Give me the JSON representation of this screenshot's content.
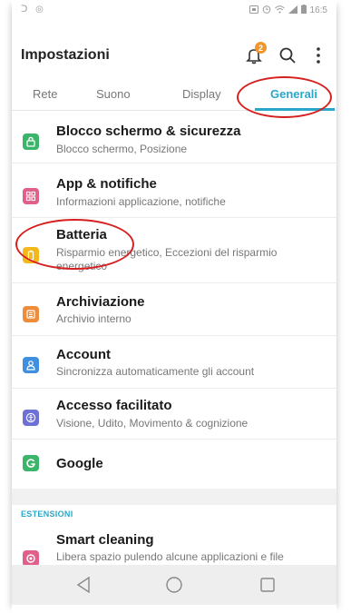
{
  "statusbar": {
    "left_icons": "ᑐ ◎",
    "time": "16:5"
  },
  "appbar": {
    "title": "Impostazioni",
    "notification_count": "2"
  },
  "tabs": [
    {
      "label": "Rete"
    },
    {
      "label": "Suono"
    },
    {
      "label": "Display"
    },
    {
      "label": "Generali"
    }
  ],
  "items": [
    {
      "title": "Blocco schermo & sicurezza",
      "subtitle": "Blocco schermo, Posizione",
      "icon": "lock-icon",
      "color": "#3bb56a"
    },
    {
      "title": "App & notifiche",
      "subtitle": "Informazioni applicazione, notifiche",
      "icon": "apps-icon",
      "color": "#e0608a"
    },
    {
      "title": "Batteria",
      "subtitle": "Risparmio energetico, Eccezioni del risparmio energetico",
      "icon": "battery-icon",
      "color": "#f2b81c"
    },
    {
      "title": "Archiviazione",
      "subtitle": "Archivio interno",
      "icon": "storage-icon",
      "color": "#ee8c39"
    },
    {
      "title": "Account",
      "subtitle": "Sincronizza automaticamente gli account",
      "icon": "account-icon",
      "color": "#3e8fe0"
    },
    {
      "title": "Accesso facilitato",
      "subtitle": "Visione, Udito, Movimento & cognizione",
      "icon": "accessibility-icon",
      "color": "#6e71d6"
    },
    {
      "title": "Google",
      "subtitle": "",
      "icon": "google-icon",
      "color": "#3bb56a"
    }
  ],
  "section": {
    "label": "ESTENSIONI"
  },
  "extensions": [
    {
      "title": "Smart cleaning",
      "subtitle": "Libera spazio pulendo alcune applicazioni e file",
      "icon": "cleaning-icon",
      "color": "#e0608a"
    }
  ],
  "annotation_color": "#d62020"
}
